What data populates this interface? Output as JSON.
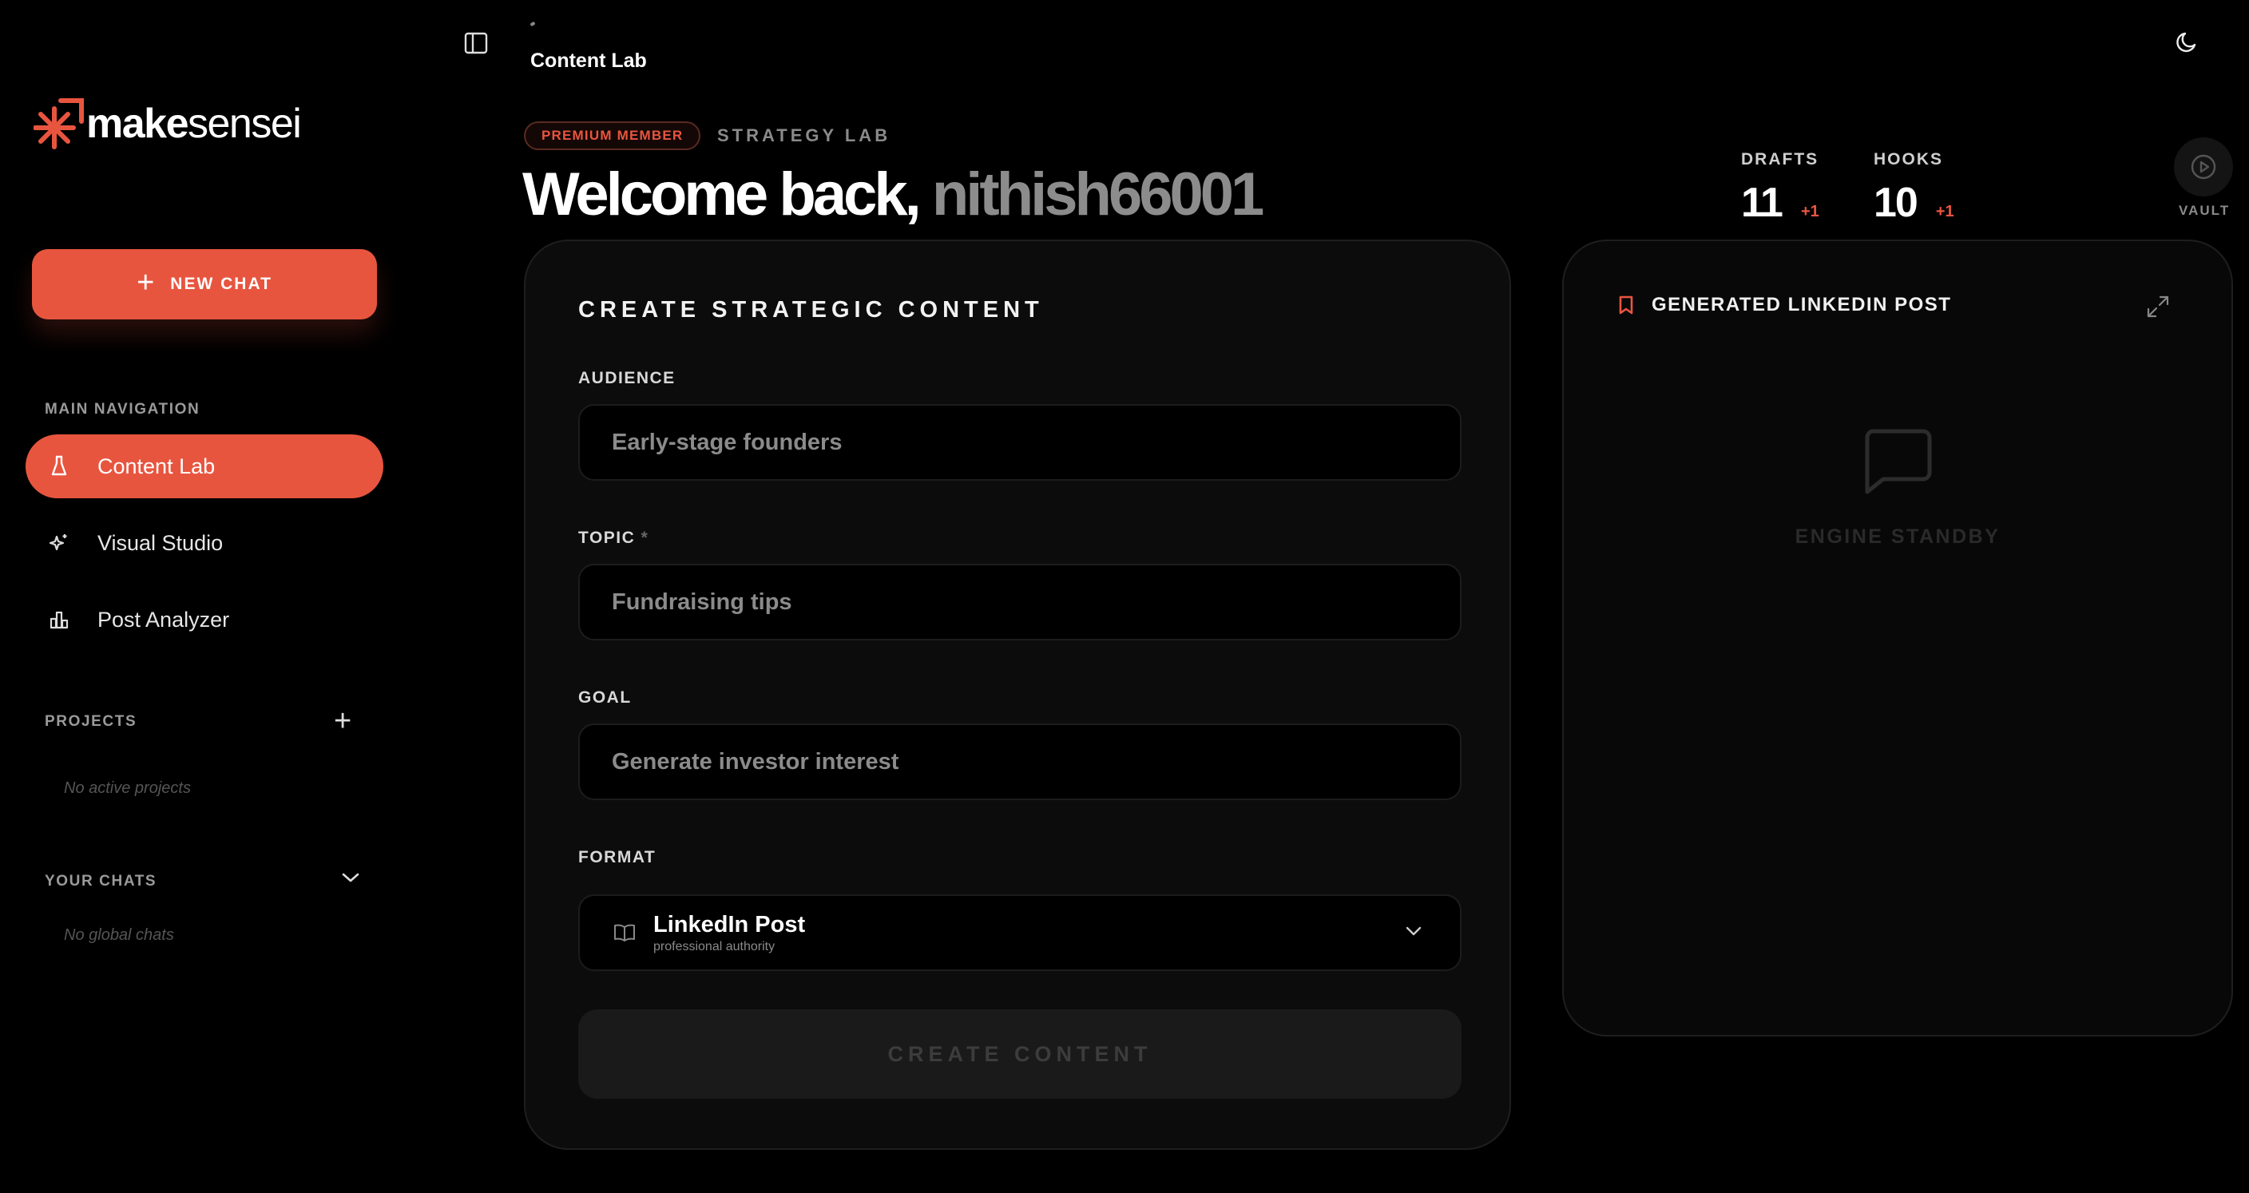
{
  "brand": {
    "name_bold": "make",
    "name_light": "sensei",
    "accent": "#e8553f"
  },
  "sidebar": {
    "new_chat_label": "NEW CHAT",
    "main_nav_label": "MAIN NAVIGATION",
    "items": [
      {
        "label": "Content Lab",
        "icon": "flask-icon",
        "active": true
      },
      {
        "label": "Visual Studio",
        "icon": "sparkles-icon",
        "active": false
      },
      {
        "label": "Post Analyzer",
        "icon": "bar-chart-icon",
        "active": false
      }
    ],
    "projects_label": "PROJECTS",
    "projects_empty": "No active projects",
    "chats_label": "YOUR CHATS",
    "chats_empty": "No global chats"
  },
  "topbar": {
    "breadcrumb": "Content Lab"
  },
  "header": {
    "badge": "PREMIUM MEMBER",
    "section": "STRATEGY LAB",
    "welcome_prefix": "Welcome back,",
    "username": "nithish66001"
  },
  "stats": [
    {
      "label": "DRAFTS",
      "value": "11",
      "delta": "+1"
    },
    {
      "label": "HOOKS",
      "value": "10",
      "delta": "+1"
    }
  ],
  "vault_label": "VAULT",
  "form": {
    "title": "CREATE STRATEGIC CONTENT",
    "audience_label": "AUDIENCE",
    "audience_placeholder": "Early-stage founders",
    "topic_label": "TOPIC",
    "topic_required": "*",
    "topic_placeholder": "Fundraising tips",
    "goal_label": "GOAL",
    "goal_placeholder": "Generate investor interest",
    "format_label": "FORMAT",
    "format_value": "LinkedIn Post",
    "format_sub": "professional authority",
    "submit_label": "CREATE CONTENT"
  },
  "output": {
    "title": "GENERATED LINKEDIN POST",
    "status": "ENGINE STANDBY"
  }
}
